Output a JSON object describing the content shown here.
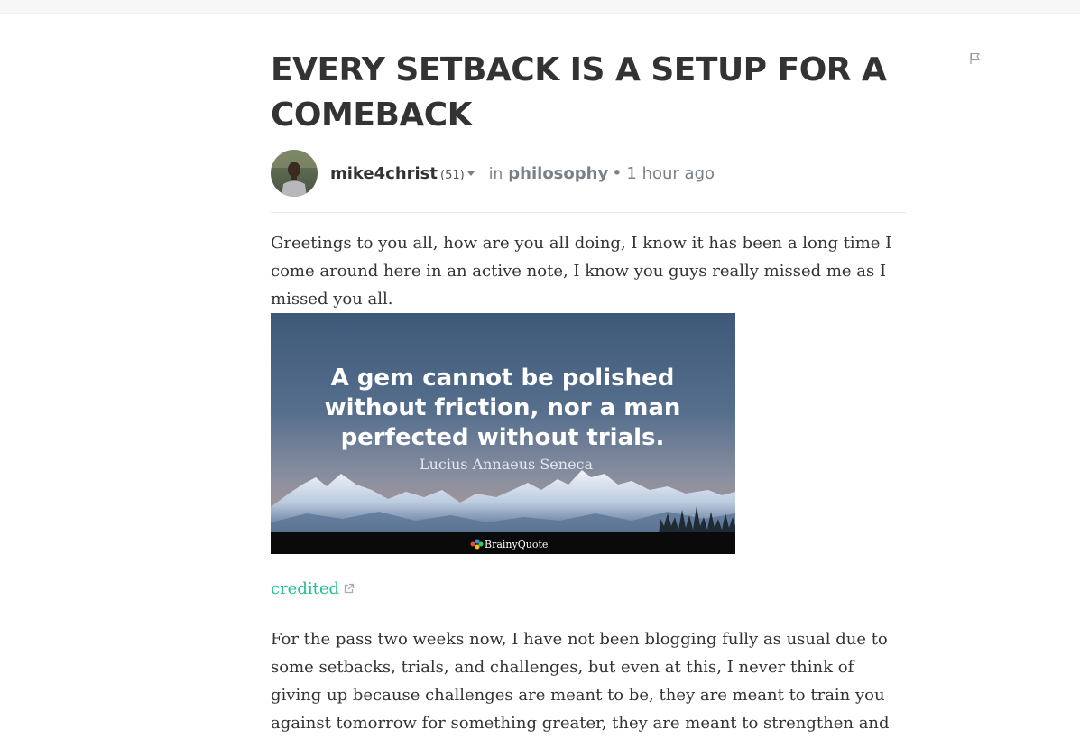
{
  "post": {
    "title": "EVERY SETBACK IS A SETUP FOR A COMEBACK",
    "author": {
      "name": "mike4christ",
      "reputation": "(51)"
    },
    "in_label": "in",
    "category": "philosophy",
    "dot": "•",
    "time": "1 hour ago",
    "paragraph1": "Greetings to you all, how are you all doing, I know it has been a long time I come around here in an active note, I know you guys really missed me as I missed you all.",
    "image": {
      "quote_line1": "A gem cannot be polished",
      "quote_line2": "without friction, nor a man",
      "quote_line3": "perfected without trials.",
      "quote_author": "Lucius Annaeus Seneca",
      "brand": "BrainyQuote"
    },
    "credit_link": "credited",
    "paragraph2": "For the pass two weeks now, I have not been blogging fully as usual due to some setbacks, trials, and challenges, but even at this, I never think of giving up because challenges are meant to be, they are meant to train you against tomorrow for something greater, they are meant to strengthen and"
  },
  "icons": {
    "flag": "flag-icon",
    "external": "external-link-icon",
    "caret": "chevron-down-icon"
  },
  "colors": {
    "link": "#1fbf8f",
    "muted": "#788187",
    "text": "#333333"
  }
}
